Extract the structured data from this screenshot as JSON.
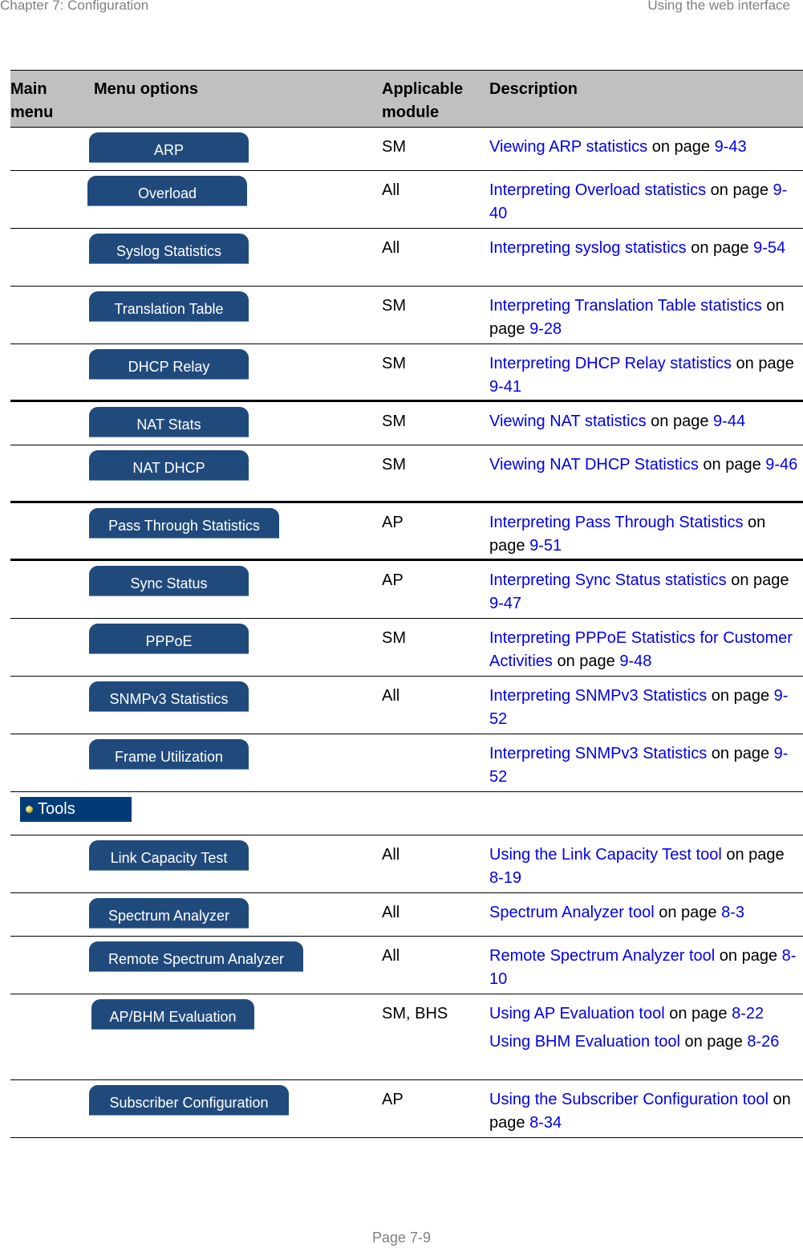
{
  "running_header": {
    "left": "Chapter 7:  Configuration",
    "right": "Using the web interface"
  },
  "table": {
    "headers": {
      "main_menu": "Main\nmenu",
      "menu_options": "Menu options",
      "applicable_module": "Applicable\nmodule",
      "description": "Description"
    },
    "rows": [
      {
        "button": "ARP",
        "module": "SM",
        "desc": [
          {
            "link": "Viewing ARP statistics",
            "mid": " on page ",
            "page": "9-43"
          }
        ]
      },
      {
        "button": "Overload",
        "module": "All",
        "desc": [
          {
            "link": "Interpreting Overload statistics",
            "mid": " on page ",
            "page": "9-40"
          }
        ]
      },
      {
        "button": "Syslog Statistics",
        "module": "All",
        "desc": [
          {
            "link": "Interpreting syslog statistics",
            "mid": " on page ",
            "page": "9-54"
          }
        ]
      },
      {
        "button": "Translation Table",
        "module": "SM",
        "desc": [
          {
            "link": "Interpreting Translation Table statistics",
            "mid": " on page ",
            "page": "9-28"
          }
        ]
      },
      {
        "button": "DHCP Relay",
        "module": "SM",
        "desc": [
          {
            "link": "Interpreting DHCP Relay statistics",
            "mid": " on page ",
            "page": "9-41"
          }
        ]
      },
      {
        "button": "NAT Stats",
        "module": "SM",
        "desc": [
          {
            "link": "Viewing NAT statistics",
            "mid": " on page ",
            "page": "9-44"
          }
        ]
      },
      {
        "button": "NAT DHCP",
        "module": "SM",
        "desc": [
          {
            "link": "Viewing NAT DHCP Statistics",
            "mid": " on page ",
            "page": "9-46"
          }
        ]
      },
      {
        "button": "Pass Through Statistics",
        "module": "AP",
        "desc": [
          {
            "link": "Interpreting Pass Through Statistics",
            "mid": " on page ",
            "page": "9-51"
          }
        ]
      },
      {
        "button": "Sync Status",
        "module": "AP",
        "desc": [
          {
            "link": "Interpreting Sync Status statistics",
            "mid": " on page ",
            "page": "9-47"
          }
        ]
      },
      {
        "button": "PPPoE",
        "module": "SM",
        "desc": [
          {
            "link": "Interpreting PPPoE Statistics for Customer Activities",
            "mid": " on page ",
            "page": "9-48"
          }
        ]
      },
      {
        "button": "SNMPv3 Statistics",
        "module": "All",
        "desc": [
          {
            "link": "Interpreting SNMPv3 Statistics",
            "mid": " on page ",
            "page": "9-52"
          }
        ]
      },
      {
        "button": "Frame Utilization",
        "module": "",
        "desc": [
          {
            "link": "Interpreting SNMPv3 Statistics",
            "mid": " on page ",
            "page": "9-52"
          }
        ]
      },
      {
        "section": "Tools"
      },
      {
        "button": "Link Capacity Test",
        "module": "All",
        "desc": [
          {
            "link": "Using the Link Capacity Test tool",
            "mid": " on page ",
            "page": "8-19"
          }
        ]
      },
      {
        "button": "Spectrum Analyzer",
        "module": "All",
        "desc": [
          {
            "link": "Spectrum Analyzer tool",
            "mid": " on page ",
            "page": "8-3"
          }
        ]
      },
      {
        "button": "Remote Spectrum Analyzer",
        "module": "All",
        "desc": [
          {
            "link": "Remote Spectrum Analyzer tool",
            "mid": " on page ",
            "page": "8-10"
          }
        ]
      },
      {
        "button": "AP/BHM Evaluation",
        "module": "SM, BHS",
        "desc": [
          {
            "link": "Using AP Evaluation tool",
            "mid": " on page ",
            "page": "8-22"
          },
          {
            "link": "Using BHM Evaluation tool",
            "mid": " on page ",
            "page": "8-26"
          }
        ]
      },
      {
        "button": "Subscriber Configuration",
        "module": "AP",
        "desc": [
          {
            "link": "Using the Subscriber Configuration tool",
            "mid": " on page ",
            "page": "8-34"
          }
        ]
      }
    ]
  },
  "footer": {
    "page_label": "Page 7-9"
  },
  "colors": {
    "button_fill": "#214a7c",
    "tools_fill": "#003b78",
    "link": "#0000ee",
    "header_fill": "#c0c0c0"
  }
}
